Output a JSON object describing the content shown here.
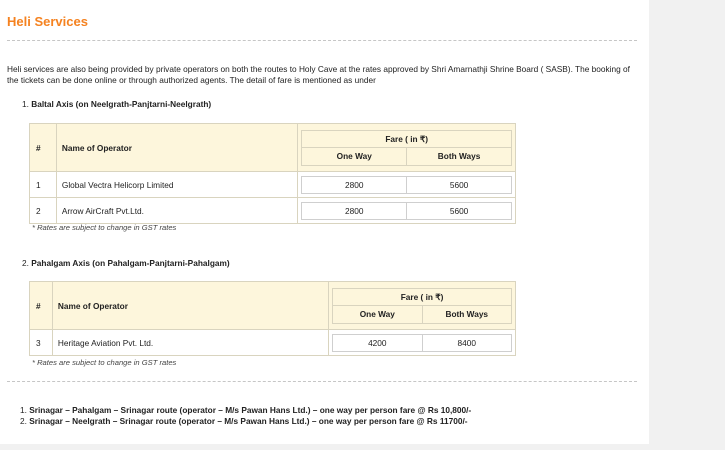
{
  "page": {
    "title": "Heli Services",
    "intro": "Heli services are also being provided by private operators on both the routes to Holy Cave at the rates approved by Shri Amarnathji Shrine Board ( SASB). The booking of the tickets can be done online or through authorized agents. The detail of fare is mentioned as under"
  },
  "sections": [
    {
      "number": "1.",
      "heading": "Baltal Axis (on Neelgrath-Panjtarni-Neelgrath)",
      "table": {
        "col_num": "#",
        "col_operator": "Name of Operator",
        "fare_label": "Fare ( in ₹)",
        "col_oneway": "One Way",
        "col_bothways": "Both Ways",
        "rows": [
          {
            "num": "1",
            "operator": "Global Vectra Helicorp Limited",
            "oneway": "2800",
            "bothways": "5600"
          },
          {
            "num": "2",
            "operator": "Arrow AirCraft Pvt.Ltd.",
            "oneway": "2800",
            "bothways": "5600"
          }
        ]
      },
      "note": "* Rates are subject to change in GST rates"
    },
    {
      "number": "2.",
      "heading": "Pahalgam Axis (on Pahalgam-Panjtarni-Pahalgam)",
      "table": {
        "col_num": "#",
        "col_operator": "Name of Operator",
        "fare_label": "Fare ( in ₹)",
        "col_oneway": "One Way",
        "col_bothways": "Both Ways",
        "rows": [
          {
            "num": "3",
            "operator": "Heritage Aviation Pvt. Ltd.",
            "oneway": "4200",
            "bothways": "8400"
          }
        ]
      },
      "note": "* Rates are subject to change in GST rates"
    }
  ],
  "routes": [
    {
      "number": "1.",
      "text": "Srinagar – Pahalgam – Srinagar route (operator – M/s Pawan Hans Ltd.) – one way per person fare @ Rs 10,800/-"
    },
    {
      "number": "2.",
      "text": "Srinagar – Neelgrath – Srinagar route (operator – M/s Pawan Hans Ltd.) – one way per person fare @ Rs 11700/-"
    }
  ]
}
